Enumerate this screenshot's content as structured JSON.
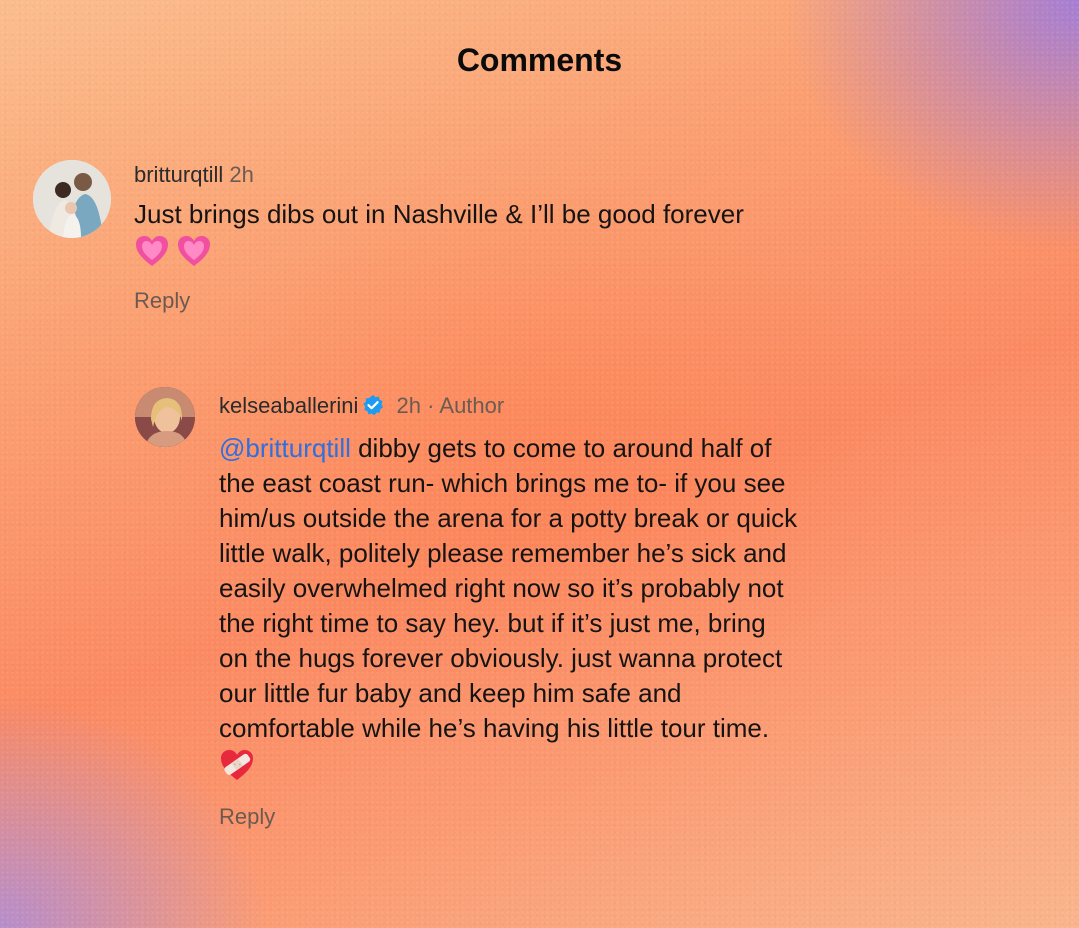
{
  "header": {
    "title": "Comments"
  },
  "comments": [
    {
      "username": "britturqtill",
      "time": "2h",
      "text_lines": [
        "Just brings dibs out in Nashville & I’ll be good forever"
      ],
      "emoji": [
        "growing-heart-icon",
        "growing-heart-icon"
      ],
      "reply_label": "Reply"
    },
    {
      "username": "kelseaballerini",
      "verified": true,
      "time": "2h",
      "separator": "·",
      "author_label": "Author",
      "mention": "@britturqtill",
      "text_lines": [
        " dibby gets to come to around half of",
        "the east coast run- which brings me to- if you see",
        "him/us outside the arena for a potty break or quick",
        "little walk, politely please remember he’s sick and",
        "easily overwhelmed right now so it’s probably not",
        "the right time to say hey. but if it’s just me, bring",
        "on the hugs forever obviously. just wanna protect",
        "our little fur baby and keep him safe and",
        "comfortable while he’s having his little tour time."
      ],
      "emoji": [
        "mending-heart-icon"
      ],
      "reply_label": "Reply"
    }
  ],
  "colors": {
    "mention": "#2f6fe0",
    "verified": "#1d9bf0",
    "heart": "#f14fa0"
  }
}
